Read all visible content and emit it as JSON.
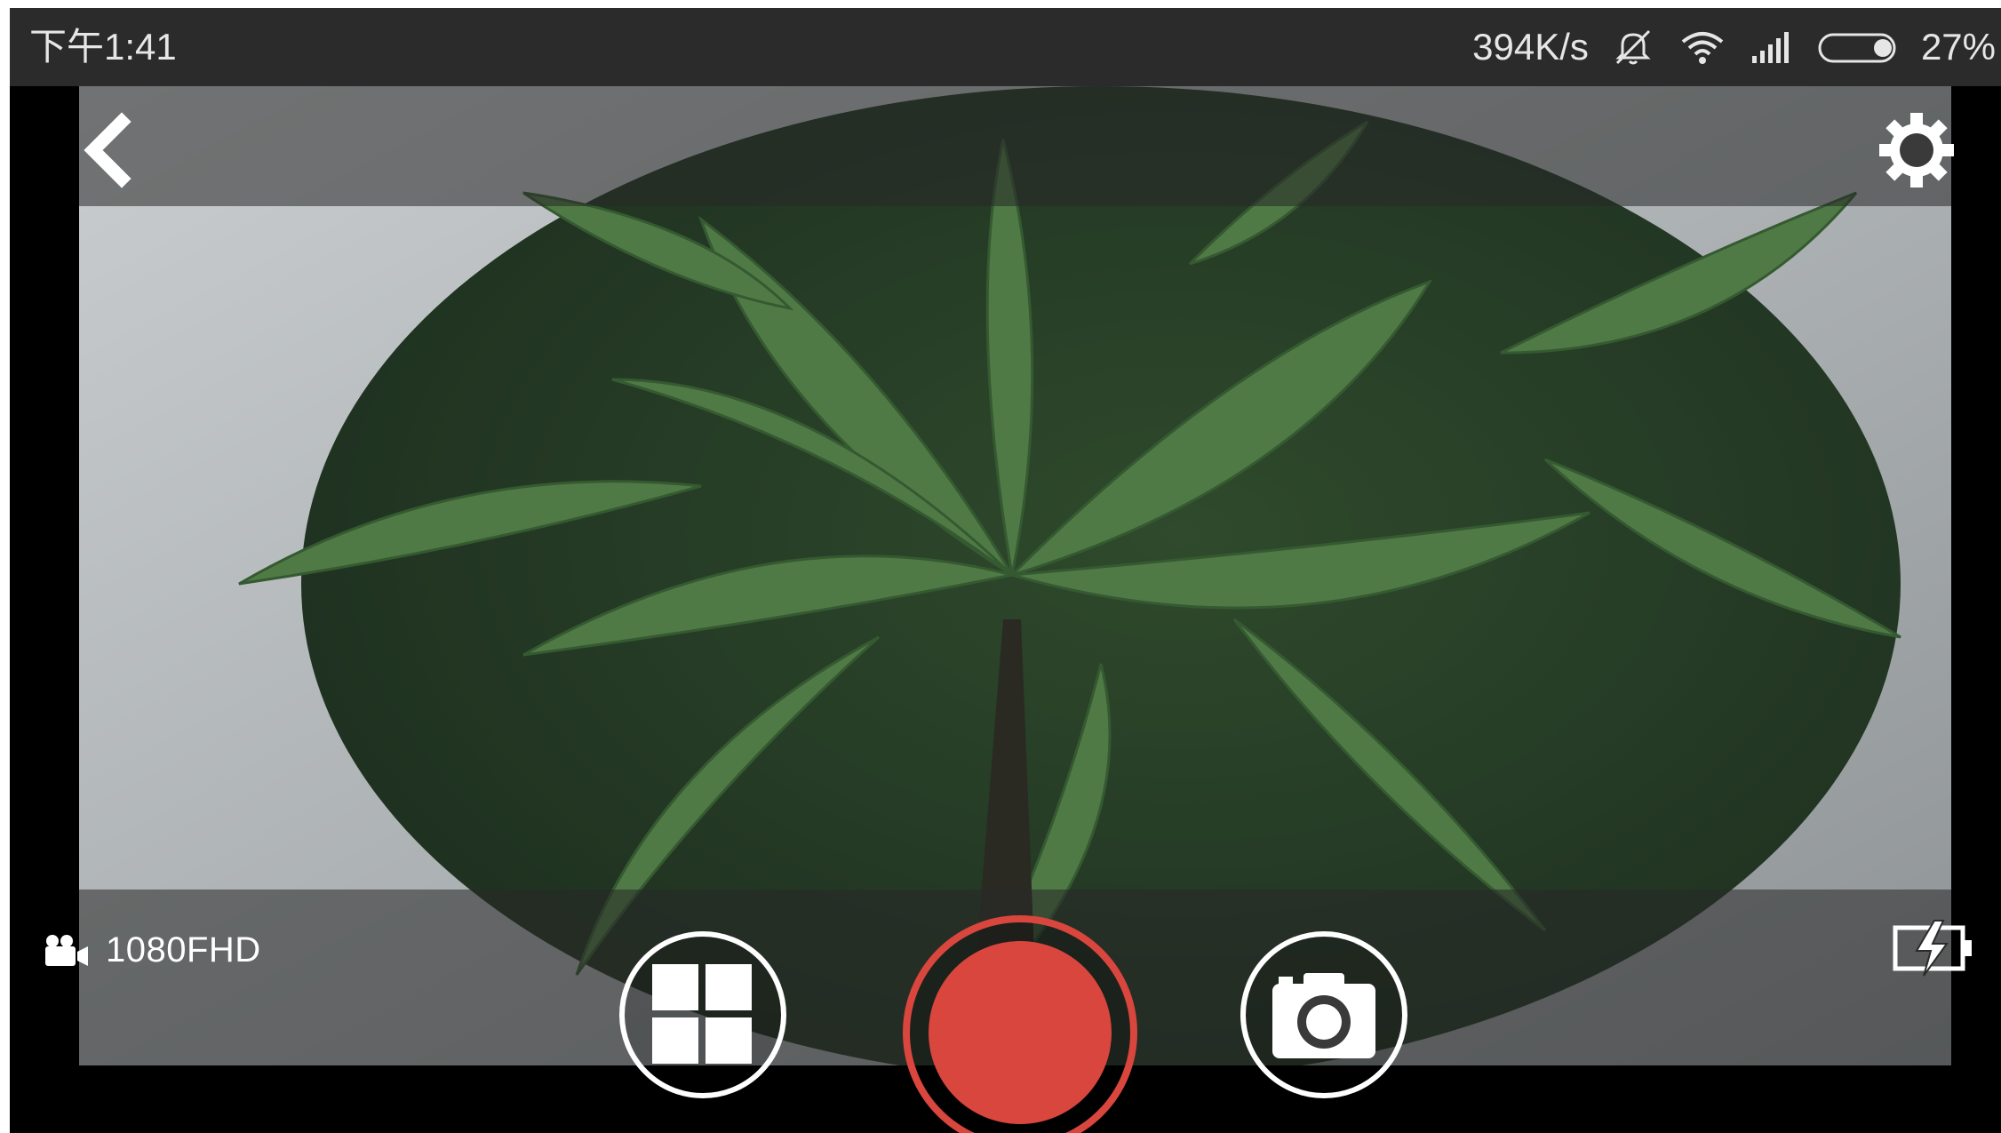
{
  "status_bar": {
    "time": "下午1:41",
    "network_speed": "394K/s",
    "battery_percent": "27%",
    "battery_level": 0.27,
    "icons": [
      "mute-icon",
      "wifi-icon",
      "signal-icon",
      "battery-icon"
    ]
  },
  "top_bar": {
    "back_icon": "chevron-left-icon",
    "settings_icon": "gear-icon"
  },
  "bottom_bar": {
    "resolution_label": "1080FHD",
    "resolution_icon": "video-camera-icon",
    "gallery_icon": "grid-icon",
    "record_icon": "record-icon",
    "photo_icon": "camera-icon",
    "charge_icon": "battery-charging-icon",
    "record_color": "#d9463e",
    "accent_white": "#ffffff"
  }
}
